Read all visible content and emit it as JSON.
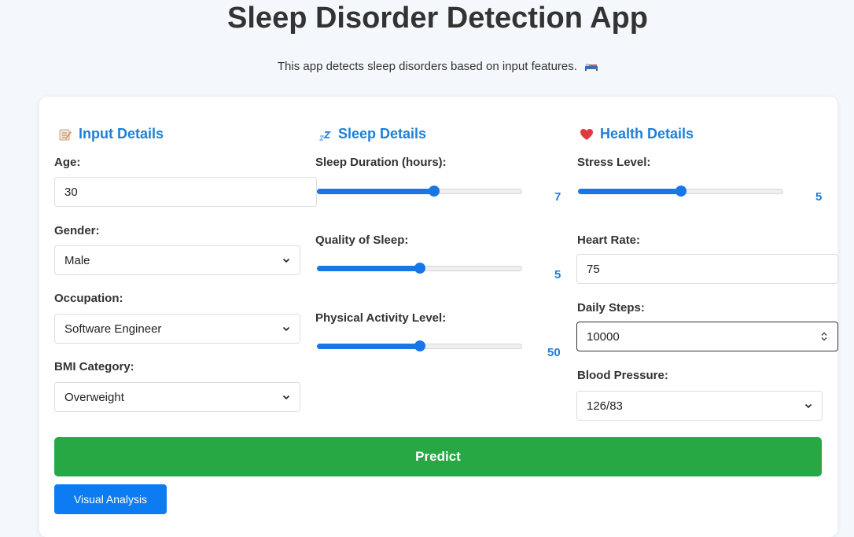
{
  "app": {
    "title": "Sleep Disorder Detection App",
    "subtitle": "This app detects sleep disorders based on input features.",
    "subtitle_icon": "bed-icon"
  },
  "input_details": {
    "title": "Input Details",
    "icon": "memo-icon",
    "age_label": "Age:",
    "age_value": "30",
    "gender_label": "Gender:",
    "gender_value": "Male",
    "occupation_label": "Occupation:",
    "occupation_value": "Software Engineer",
    "bmi_label": "BMI Category:",
    "bmi_value": "Overweight"
  },
  "sleep_details": {
    "title": "Sleep Details",
    "icon": "zzz-icon",
    "sleep_duration_label": "Sleep Duration (hours):",
    "sleep_duration_value": "7",
    "sleep_duration_fraction": 0.57,
    "quality_label": "Quality of Sleep:",
    "quality_value": "5",
    "quality_fraction": 0.5,
    "activity_label": "Physical Activity Level:",
    "activity_value": "50",
    "activity_fraction": 0.5
  },
  "health_details": {
    "title": "Health Details",
    "icon": "heart-icon",
    "stress_label": "Stress Level:",
    "stress_value": "5",
    "stress_fraction": 0.5,
    "heart_rate_label": "Heart Rate:",
    "heart_rate_value": "75",
    "daily_steps_label": "Daily Steps:",
    "daily_steps_value": "10000",
    "blood_pressure_label": "Blood Pressure:",
    "blood_pressure_value": "126/83"
  },
  "actions": {
    "predict_label": "Predict",
    "visual_label": "Visual Analysis"
  },
  "colors": {
    "accent_blue": "#1e7fd6",
    "slider_blue": "#1777e6",
    "predict_green": "#28a745",
    "visual_blue": "#0d7bf2"
  }
}
